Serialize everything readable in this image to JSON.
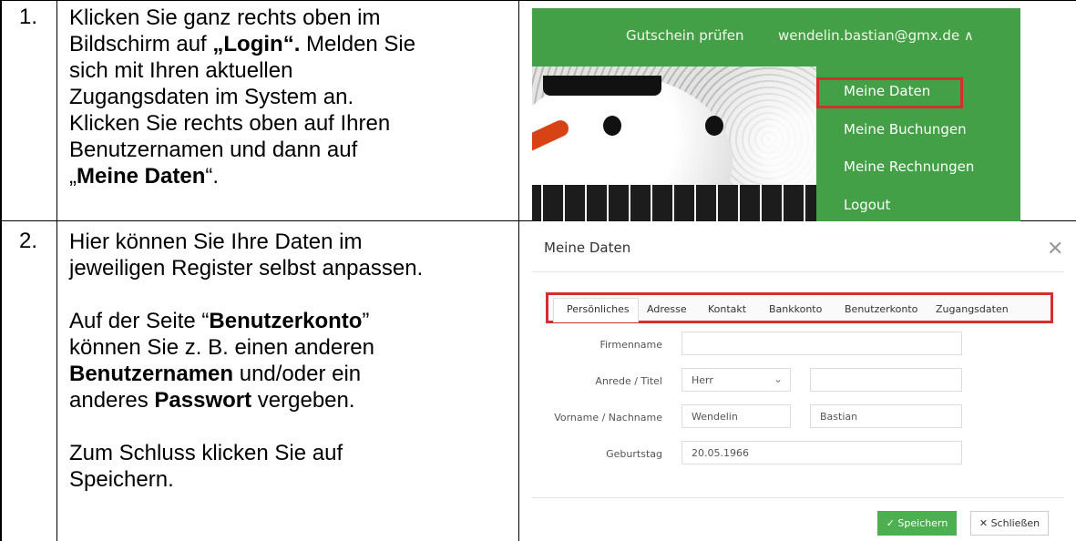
{
  "rows": [
    {
      "number": "1.",
      "lines": [
        {
          "a": "Klicken Sie ganz rechts oben im",
          "b": "",
          "c": ""
        },
        {
          "a": "Bildschirm auf ",
          "b": "„Login“.",
          "c": " Melden Sie"
        },
        {
          "a": "sich mit Ihren aktuellen",
          "b": "",
          "c": ""
        },
        {
          "a": "Zugangsdaten im System an.",
          "b": "",
          "c": ""
        },
        {
          "a": "Klicken Sie rechts oben auf Ihren",
          "b": "",
          "c": ""
        },
        {
          "a": "Benutzernamen und dann auf",
          "b": "",
          "c": ""
        },
        {
          "a": "„",
          "b": "Meine Daten",
          "c": "“."
        }
      ]
    },
    {
      "number": "2.",
      "lines": [
        {
          "a": "Hier können Sie Ihre Daten im",
          "b": "",
          "c": ""
        },
        {
          "a": "jeweiligen Register selbst anpassen.",
          "b": "",
          "c": ""
        },
        {
          "a": "Auf der Seite “",
          "b": "Benutzerkonto",
          "c": "”"
        },
        {
          "a": "können Sie z. B. einen anderen",
          "b": "",
          "c": ""
        },
        {
          "a": "",
          "b": "Benutzernamen",
          "c": " und/oder ein"
        },
        {
          "a": "anderes ",
          "b": "Passwort",
          "c": " vergeben."
        },
        {
          "a": "Zum Schluss klicken Sie auf",
          "b": "",
          "c": ""
        },
        {
          "a": "Speichern.",
          "b": "",
          "c": ""
        }
      ]
    }
  ],
  "shot1": {
    "nav_voucher": "Gutschein prüfen",
    "nav_user": "wendelin.bastian@gmx.de ∧",
    "menu": [
      "Meine Daten",
      "Meine Buchungen",
      "Meine Rechnungen",
      "Logout"
    ],
    "colors": {
      "green": "#43a047",
      "highlight": "#d32f2f"
    }
  },
  "shot2": {
    "title": "Meine Daten",
    "close_glyph": "✕",
    "tabs": [
      "Persönliches",
      "Adresse",
      "Kontakt",
      "Bankkonto",
      "Benutzerkonto",
      "Zugangsdaten"
    ],
    "active_tab": "Persönliches",
    "labels": {
      "company": "Firmenname",
      "salutation": "Anrede / Titel",
      "name": "Vorname / Nachname",
      "birthday": "Geburtstag"
    },
    "values": {
      "company": "",
      "salutation": "Herr",
      "title": "",
      "first_name": "Wendelin",
      "last_name": "Bastian",
      "birthday": "20.05.1966"
    },
    "buttons": {
      "save": "✓ Speichern",
      "close": "✕ Schließen"
    }
  }
}
